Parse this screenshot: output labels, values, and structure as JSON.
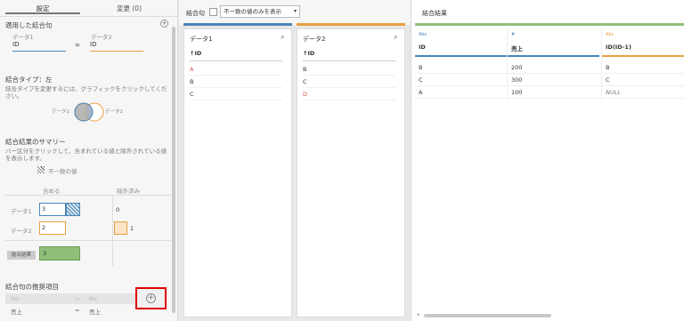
{
  "left_tabs": [
    "設定",
    "変更 (0)"
  ],
  "applied_join": {
    "title": "適用した結合句",
    "left_label": "データ1",
    "right_label": "データ2",
    "left_field": "ID",
    "operator": "=",
    "right_field": "ID"
  },
  "join_type": {
    "title": "結合タイプ：左",
    "desc": "結合タイプを変更するには、グラフィックをクリックしてください。",
    "left_label": "データ1",
    "right_label": "データ2"
  },
  "summary": {
    "title": "結合結果のサマリー",
    "desc": "バー区分をクリックして、含まれている値と除外されている値を表示します。",
    "legend": "不一致の値",
    "col_included": "含める",
    "col_excluded": "除外済み",
    "rows": [
      {
        "label": "データ1",
        "included": "3",
        "excluded": "0"
      },
      {
        "label": "データ2",
        "included": "2",
        "excluded": "1"
      }
    ],
    "result_label": "結合結果",
    "result_value": "3"
  },
  "recommend": {
    "title": "結合句の推奨項目",
    "rows": [
      {
        "left": "No",
        "op": "=",
        "right": "No"
      },
      {
        "left": "売上",
        "op": "=",
        "right": "売上"
      }
    ]
  },
  "mid_header": {
    "label": "結合句",
    "checkbox_label": "不一致の値のみを表示"
  },
  "data1": {
    "title": "データ1",
    "field": "↑ID",
    "values": [
      "A",
      "B",
      "C"
    ],
    "value_colors": [
      "#d9534f",
      "#333333",
      "#333333"
    ]
  },
  "data2": {
    "title": "データ2",
    "field": "↑ID",
    "values": [
      "B",
      "C",
      "D"
    ],
    "value_colors": [
      "#333333",
      "#333333",
      "#d9534f"
    ]
  },
  "result": {
    "title": "結合結果",
    "columns": [
      {
        "type": "Abc",
        "name": "ID",
        "color": "#4a86b8"
      },
      {
        "type": "#",
        "name": "売上",
        "color": "#4a86b8"
      },
      {
        "type": "Abc",
        "name": "ID(ID-1)",
        "color": "#e8a040"
      }
    ],
    "rows": [
      [
        "B",
        "200",
        "B"
      ],
      [
        "C",
        "300",
        "C"
      ],
      [
        "A",
        "100",
        "NULL"
      ]
    ]
  },
  "colors": {
    "blue": "#4a86b8",
    "orange": "#e8a040",
    "green": "#8fbf7a",
    "highlight": "#e00000"
  }
}
